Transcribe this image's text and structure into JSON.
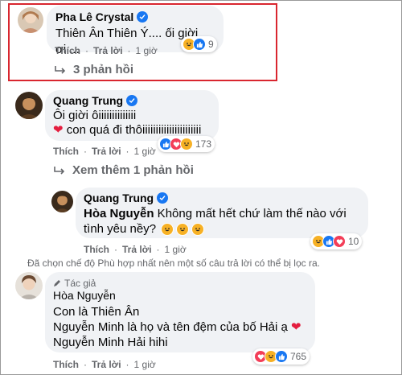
{
  "comments": [
    {
      "name": "Pha Lê Crystal",
      "text": "Thiên Ân Thiên Ý.... ối giời ơi....",
      "like_label": "Thích",
      "reply_label": "Trả lời",
      "time": "1 giờ",
      "reaction_count": "9",
      "replies_link": "3 phản hồi"
    },
    {
      "name": "Quang Trung",
      "line1": "Ôi giời ôiiiiiiiiiiiiii",
      "line2": "con quá đi thôiiiiiiiiiiiiiiiiiiiiii",
      "like_label": "Thích",
      "reply_label": "Trả lời",
      "time": "1 giờ",
      "reaction_count": "173",
      "more_replies": "Xem thêm 1 phản hồi"
    },
    {
      "name": "Quang Trung",
      "mention": "Hòa Nguyễn",
      "text": " Không mất hết chứ làm thế nào với",
      "line2": "tình yêu nềy?",
      "like_label": "Thích",
      "reply_label": "Trả lời",
      "time": "1 giờ",
      "reaction_count": "10"
    },
    {
      "author_tag": "Tác giả",
      "name": "Hòa Nguyễn",
      "line1": "Con là Thiên Ân",
      "line2": "Nguyễn Minh là họ và tên đệm của bố Hải ạ",
      "line3": "Nguyễn Minh Hải hihi",
      "like_label": "Thích",
      "reply_label": "Trả lời",
      "time": "1 giờ",
      "reaction_count": "765"
    }
  ],
  "filter_note": "Đã chọn chế độ Phù hợp nhất nên một số câu trả lời có thể bị lọc ra.",
  "colors": {
    "highlight": "#d9262f",
    "bubble": "#f0f2f5",
    "like_blue": "#1877f2",
    "haha": "#f7b125",
    "love": "#f33e58",
    "muted": "#65676b"
  }
}
